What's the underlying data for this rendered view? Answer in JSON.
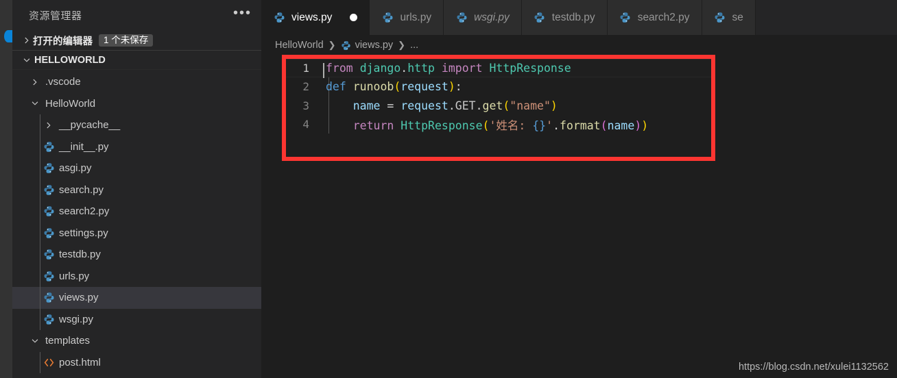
{
  "window": {
    "theme_bg": "#1e1e1e",
    "sidebar_bg": "#252526",
    "accent_red": "#fc3531"
  },
  "sidebar": {
    "title": "资源管理器",
    "more_label": "•••",
    "open_editors": {
      "label": "打开的编辑器",
      "badge": "1 个未保存"
    },
    "workspace": {
      "label": "HELLOWORLD"
    },
    "tree": [
      {
        "label": ".vscode",
        "type": "folder",
        "expanded": false,
        "depth": 1,
        "icon": "chevron-right-icon"
      },
      {
        "label": "HelloWorld",
        "type": "folder",
        "expanded": true,
        "depth": 1,
        "icon": "chevron-down-icon"
      },
      {
        "label": "__pycache__",
        "type": "folder",
        "expanded": false,
        "depth": 2,
        "icon": "chevron-right-icon"
      },
      {
        "label": "__init__.py",
        "type": "file",
        "depth": 2,
        "icon": "python-file-icon"
      },
      {
        "label": "asgi.py",
        "type": "file",
        "depth": 2,
        "icon": "python-file-icon"
      },
      {
        "label": "search.py",
        "type": "file",
        "depth": 2,
        "icon": "python-file-icon"
      },
      {
        "label": "search2.py",
        "type": "file",
        "depth": 2,
        "icon": "python-file-icon"
      },
      {
        "label": "settings.py",
        "type": "file",
        "depth": 2,
        "icon": "python-file-icon"
      },
      {
        "label": "testdb.py",
        "type": "file",
        "depth": 2,
        "icon": "python-file-icon"
      },
      {
        "label": "urls.py",
        "type": "file",
        "depth": 2,
        "icon": "python-file-icon"
      },
      {
        "label": "views.py",
        "type": "file",
        "depth": 2,
        "icon": "python-file-icon",
        "selected": true
      },
      {
        "label": "wsgi.py",
        "type": "file",
        "depth": 2,
        "icon": "python-file-icon"
      },
      {
        "label": "templates",
        "type": "folder",
        "expanded": true,
        "depth": 1,
        "icon": "chevron-down-icon"
      },
      {
        "label": "post.html",
        "type": "file",
        "depth": 2,
        "icon": "html-file-icon"
      }
    ]
  },
  "tabs": [
    {
      "label": "views.py",
      "active": true,
      "dirty": true,
      "preview": false,
      "icon": "python-file-icon"
    },
    {
      "label": "urls.py",
      "active": false,
      "dirty": false,
      "preview": false,
      "icon": "python-file-icon"
    },
    {
      "label": "wsgi.py",
      "active": false,
      "dirty": false,
      "preview": true,
      "icon": "python-file-icon"
    },
    {
      "label": "testdb.py",
      "active": false,
      "dirty": false,
      "preview": false,
      "icon": "python-file-icon"
    },
    {
      "label": "search2.py",
      "active": false,
      "dirty": false,
      "preview": false,
      "icon": "python-file-icon"
    },
    {
      "label": "se",
      "active": false,
      "dirty": false,
      "preview": false,
      "icon": "python-file-icon",
      "truncated": true
    }
  ],
  "breadcrumb": {
    "root": "HelloWorld",
    "file": "views.py",
    "ellipsis": "..."
  },
  "editor": {
    "active_line": 1,
    "line_numbers": [
      "1",
      "2",
      "3",
      "4"
    ],
    "code_lines": [
      "from django.http import HttpResponse",
      "def runoob(request):",
      "    name = request.GET.get(\"name\")",
      "    return HttpResponse('姓名: {}'.format(name))"
    ],
    "language": "python"
  },
  "annotation": {
    "highlight_color": "#fc3531",
    "shape": "rectangle"
  },
  "watermark": "https://blog.csdn.net/xulei1132562"
}
